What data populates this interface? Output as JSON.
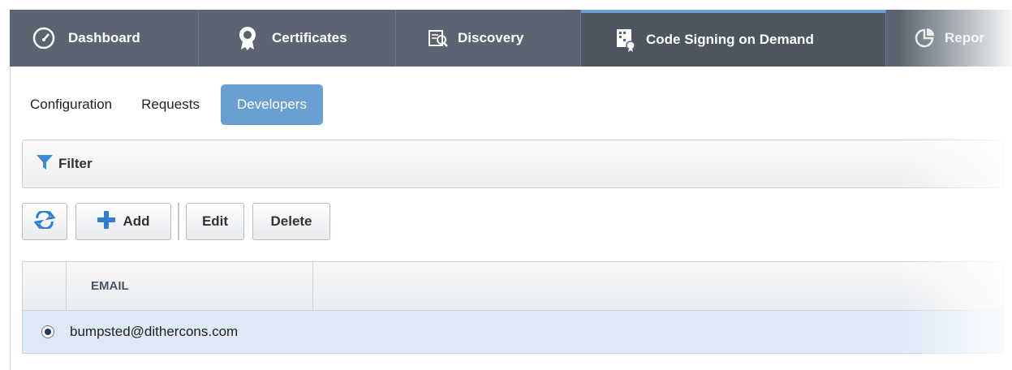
{
  "nav": {
    "tabs": [
      {
        "label": "Dashboard",
        "icon": "dashboard-gauge-icon"
      },
      {
        "label": "Certificates",
        "icon": "certificate-award-icon"
      },
      {
        "label": "Discovery",
        "icon": "discovery-icon"
      },
      {
        "label": "Code Signing on Demand",
        "icon": "code-signing-icon",
        "active": true
      },
      {
        "label": "Repor",
        "icon": "reports-pie-icon"
      }
    ]
  },
  "subtabs": [
    {
      "label": "Configuration"
    },
    {
      "label": "Requests"
    },
    {
      "label": "Developers",
      "active": true
    }
  ],
  "filter": {
    "label": "Filter",
    "icon": "filter-funnel-icon"
  },
  "toolbar": {
    "refresh_icon": "refresh-icon",
    "add_label": "Add",
    "add_icon": "plus-icon",
    "edit_label": "Edit",
    "delete_label": "Delete"
  },
  "grid": {
    "columns": [
      "EMAIL"
    ],
    "rows": [
      {
        "email": "bumpsted@dithercons.com",
        "selected": true
      }
    ]
  },
  "colors": {
    "nav_bg": "#5b6470",
    "nav_active_border": "#6f9ed6",
    "subtab_active": "#6a9fd4",
    "row_selected": "#dde9f7",
    "add_icon": "#2f7fd0"
  }
}
